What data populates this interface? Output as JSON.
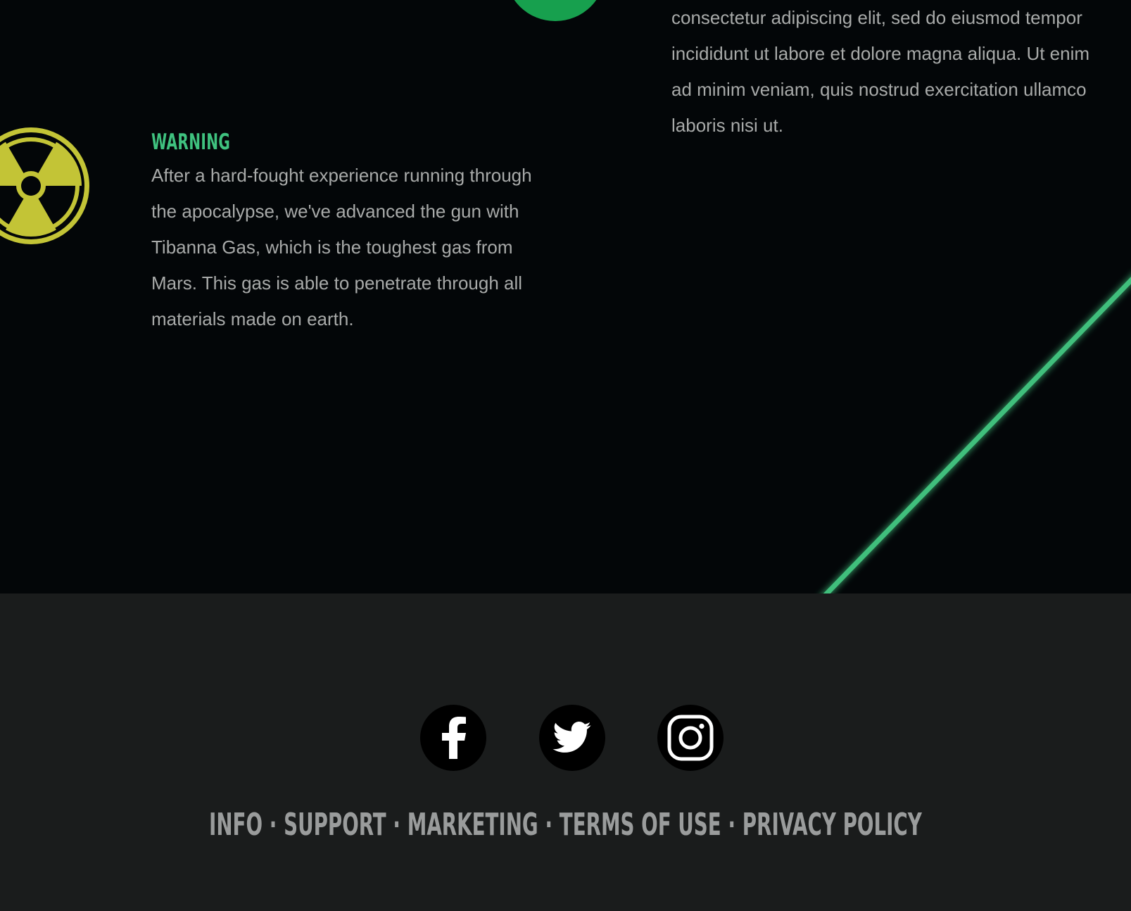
{
  "warning": {
    "title": "WARNING",
    "text": "After a hard-fought experience running through the apocalypse, we've advanced the gun with Tibanna Gas, which is the toughest gas from Mars. This gas is able to penetrate through all materials made on earth.",
    "icon": "radiation-icon"
  },
  "side_text": "consectetur adipiscing elit, sed do eiusmod tempor incididunt ut labore et dolore magna aliqua. Ut enim ad minim veniam, quis nostrud exercitation ullamco laboris nisi ut.",
  "colors": {
    "accent_green": "#3fc27f",
    "radiation_yellow": "#c3c436",
    "background": "#030608",
    "footer_background": "#1a1c1c"
  },
  "footer": {
    "social": [
      {
        "name": "facebook",
        "icon": "facebook-icon"
      },
      {
        "name": "twitter",
        "icon": "twitter-icon"
      },
      {
        "name": "instagram",
        "icon": "instagram-icon"
      }
    ],
    "links": {
      "info": "INFO",
      "support": "SUPPORT",
      "marketing": "MARKETING",
      "terms": "TERMS OF USE",
      "privacy": "PRIVACY POLICY",
      "separator": "·"
    }
  }
}
